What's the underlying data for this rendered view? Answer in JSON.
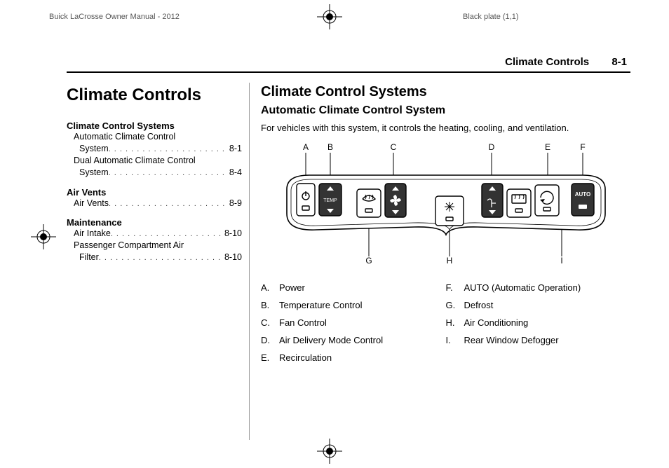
{
  "print": {
    "doc_title": "Buick LaCrosse Owner Manual - 2012",
    "plate": "Black plate (1,1)"
  },
  "running_head": {
    "section": "Climate Controls",
    "page": "8-1"
  },
  "chapter_title": "Climate Controls",
  "toc": {
    "groups": [
      {
        "title": "Climate Control Systems",
        "items": [
          {
            "label_l1": "Automatic Climate Control",
            "label_l2": "System",
            "page": "8-1"
          },
          {
            "label_l1": "Dual Automatic Climate Control",
            "label_l2": "System",
            "page": "8-4"
          }
        ]
      },
      {
        "title": "Air Vents",
        "items": [
          {
            "label_l1": "Air Vents",
            "label_l2": "",
            "page": "8-9"
          }
        ]
      },
      {
        "title": "Maintenance",
        "items": [
          {
            "label_l1": "Air Intake",
            "label_l2": "",
            "page": "8-10"
          },
          {
            "label_l1": "Passenger Compartment Air",
            "label_l2": "Filter",
            "page": "8-10"
          }
        ]
      }
    ]
  },
  "section_title": "Climate Control Systems",
  "subsection_title": "Automatic Climate Control System",
  "intro_text": "For vehicles with this system, it controls the heating, cooling, and ventilation.",
  "diagram": {
    "callouts_top": [
      "A",
      "B",
      "C",
      "D",
      "E",
      "F"
    ],
    "callouts_bottom": [
      "G",
      "H",
      "I"
    ],
    "buttons": {
      "A": "power",
      "B": "TEMP",
      "C": "fan",
      "D": "mode",
      "E": "recirc",
      "F": "AUTO",
      "G": "defrost",
      "H": "ac",
      "I": "rear-defog"
    }
  },
  "legend": {
    "left": [
      {
        "letter": "A.",
        "text": "Power"
      },
      {
        "letter": "B.",
        "text": "Temperature Control"
      },
      {
        "letter": "C.",
        "text": "Fan Control"
      },
      {
        "letter": "D.",
        "text": "Air Delivery Mode Control"
      },
      {
        "letter": "E.",
        "text": "Recirculation"
      }
    ],
    "right": [
      {
        "letter": "F.",
        "text": "AUTO (Automatic Operation)"
      },
      {
        "letter": "G.",
        "text": "Defrost"
      },
      {
        "letter": "H.",
        "text": "Air Conditioning"
      },
      {
        "letter": "I.",
        "text": "Rear Window Defogger"
      }
    ]
  }
}
